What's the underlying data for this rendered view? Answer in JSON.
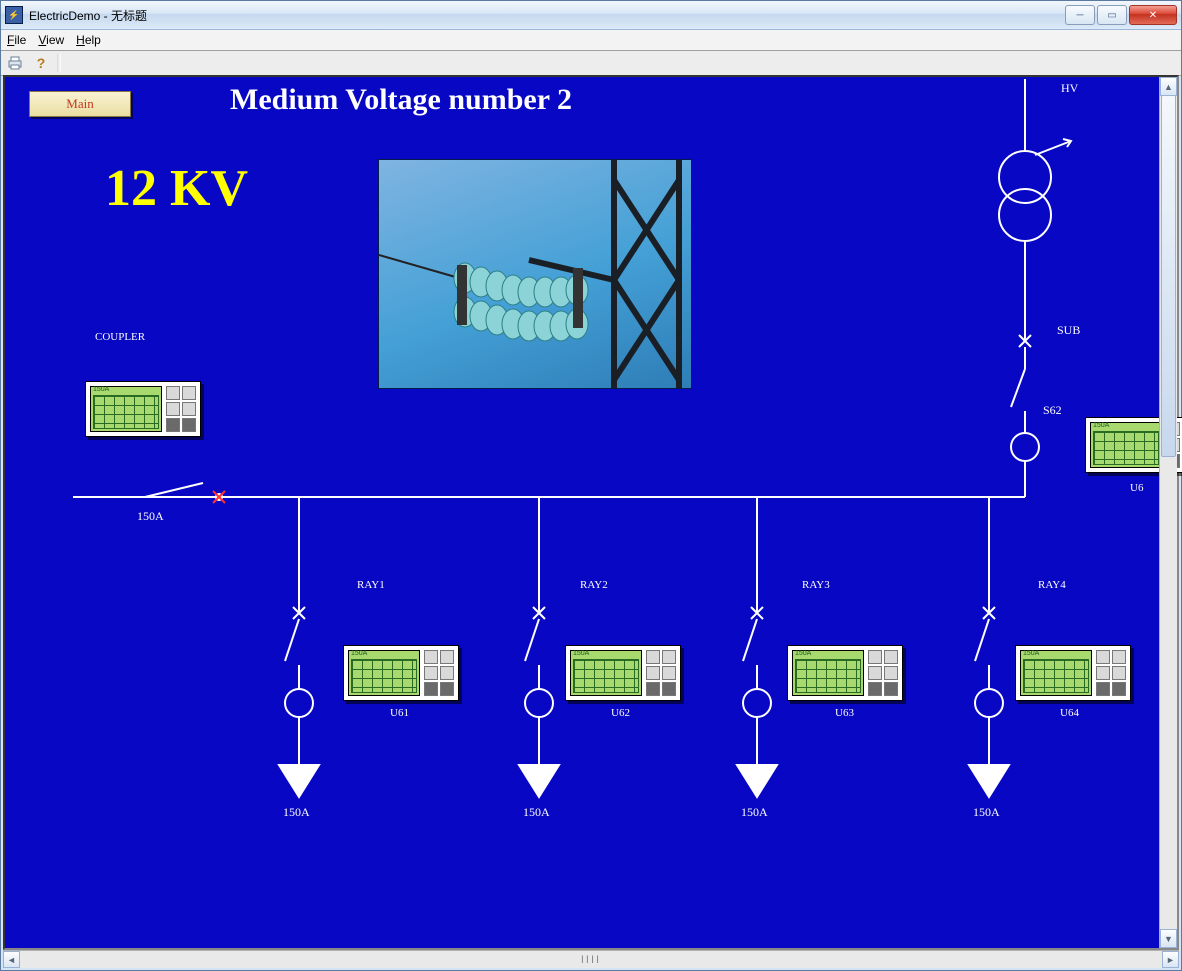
{
  "window": {
    "title": "ElectricDemo - 无标题"
  },
  "menu": {
    "file": "File",
    "view": "View",
    "help": "Help"
  },
  "buttons": {
    "main": "Main"
  },
  "page": {
    "title": "Medium Voltage number 2",
    "kv": "12 KV"
  },
  "labels": {
    "hv": "HV",
    "sub": "SUB",
    "s62": "S62",
    "coupler": "COUPLER",
    "ray1": "RAY1",
    "ray2": "RAY2",
    "ray3": "RAY3",
    "ray4": "RAY4",
    "u61": "U61",
    "u62": "U62",
    "u63": "U63",
    "u64": "U64",
    "u6": "U6"
  },
  "feeder_value": "150A",
  "coupler_switch_value": "150A",
  "scope_reading": "150A",
  "hscroll_grip": "IIII"
}
